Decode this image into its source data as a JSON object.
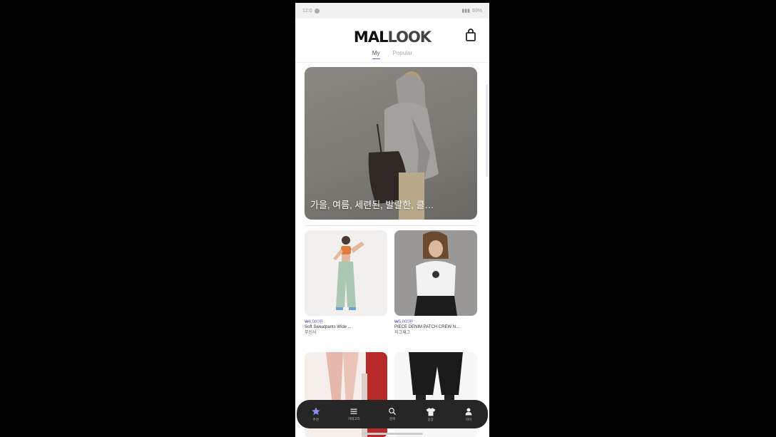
{
  "status_bar": {
    "time": "12:0",
    "right_info": "93%"
  },
  "header": {
    "logo_part1": "MAL",
    "logo_part2": "LOOK",
    "cart_icon": "shopping-bag-icon"
  },
  "tabs": [
    {
      "label": "My",
      "active": true
    },
    {
      "label": "Popular",
      "active": false
    }
  ],
  "hero": {
    "caption": "가을, 여름, 세련된, 발랄한, 클…"
  },
  "products": [
    {
      "price": "₩4,000원",
      "title": "Soft Sweatpants Wide ...",
      "brand": "무신사"
    },
    {
      "price": "₩5,000원",
      "title": "PIECE DENIM PATCH CREW N...",
      "brand": "지그재그"
    }
  ],
  "bottom_nav": [
    {
      "label": "추천",
      "icon": "star-icon",
      "active": true
    },
    {
      "label": "카테고리",
      "icon": "menu-icon",
      "active": false
    },
    {
      "label": "검색",
      "icon": "search-icon",
      "active": false
    },
    {
      "label": "옷장",
      "icon": "tshirt-icon",
      "active": false
    },
    {
      "label": "마이",
      "icon": "person-icon",
      "active": false
    }
  ],
  "colors": {
    "accent": "#6b6bcc",
    "nav_bg": "#262626"
  }
}
